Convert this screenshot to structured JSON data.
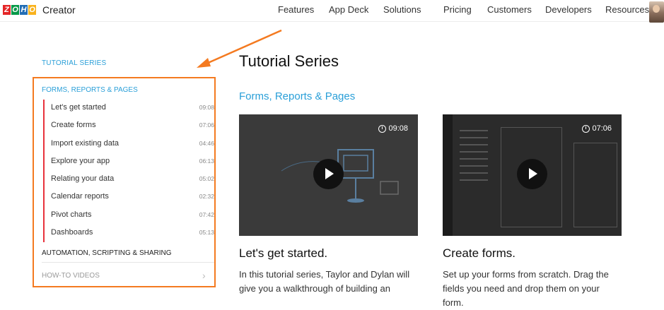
{
  "header": {
    "logo_text": "Creator",
    "nav": [
      "Features",
      "App Deck",
      "Solutions",
      "Pricing",
      "Customers",
      "Developers",
      "Resources"
    ]
  },
  "sidebar": {
    "series_link": "TUTORIAL SERIES",
    "section_title": "FORMS, REPORTS & PAGES",
    "lessons": [
      {
        "label": "Let's get started",
        "duration": "09:08"
      },
      {
        "label": "Create forms",
        "duration": "07:06"
      },
      {
        "label": "Import existing data",
        "duration": "04:46"
      },
      {
        "label": "Explore your app",
        "duration": "06:13"
      },
      {
        "label": "Relating your data",
        "duration": "05:02"
      },
      {
        "label": "Calendar reports",
        "duration": "02:32"
      },
      {
        "label": "Pivot charts",
        "duration": "07:42"
      },
      {
        "label": "Dashboards",
        "duration": "05:13"
      }
    ],
    "automation": "AUTOMATION, SCRIPTING & SHARING",
    "howto": "HOW-TO VIDEOS"
  },
  "main": {
    "title": "Tutorial Series",
    "subtitle": "Forms, Reports & Pages",
    "cards": [
      {
        "time": "09:08",
        "title": "Let's get started.",
        "desc": "In this tutorial series, Taylor and Dylan will give you a walkthrough of building an"
      },
      {
        "time": "07:06",
        "title": "Create forms.",
        "desc": "Set up your forms from scratch. Drag the fields you need and drop them on your form."
      }
    ]
  },
  "colors": {
    "accent": "#2a9fd8",
    "highlight_border": "#f47a20",
    "active_bar": "#e8323c"
  }
}
